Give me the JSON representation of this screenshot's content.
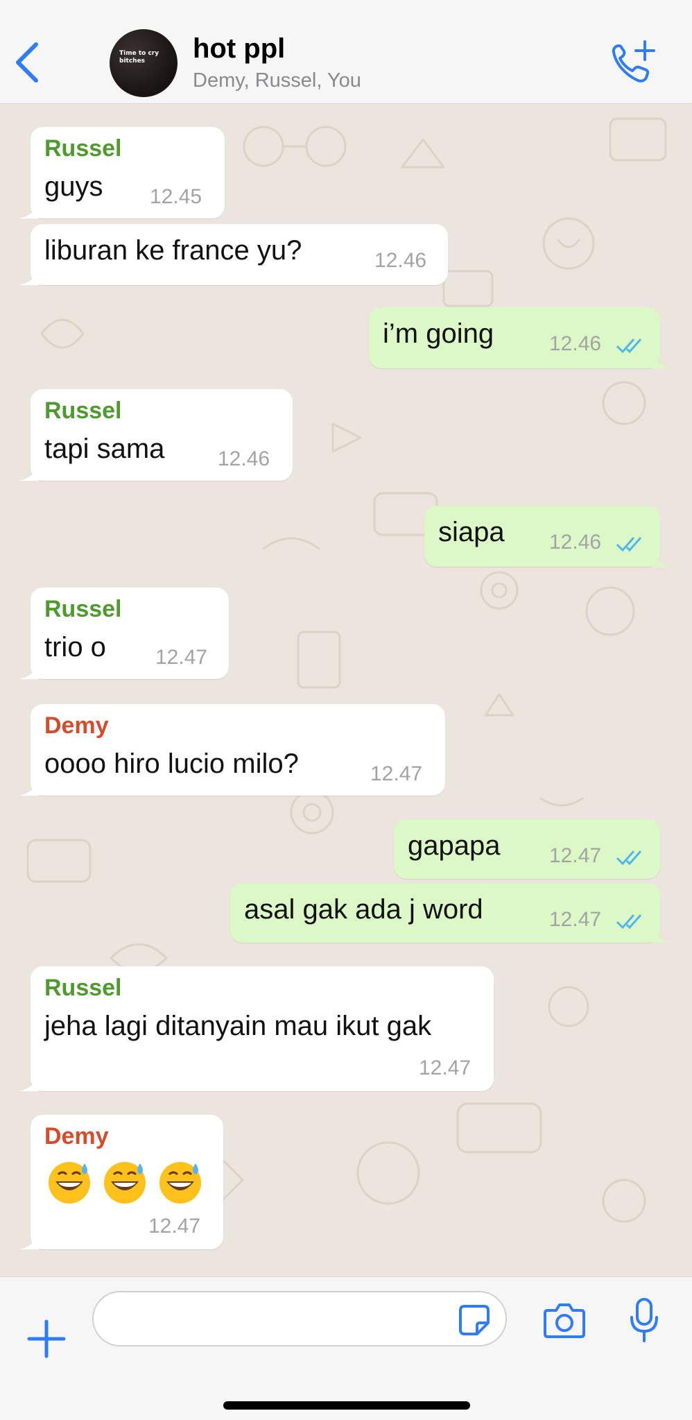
{
  "header": {
    "title": "hot ppl",
    "subtitle": "Demy, Russel, You",
    "avatar_caption": "Time to cry bitches",
    "back_icon": "chevron-left-icon",
    "call_icon": "phone-add-icon",
    "accent_color": "#2e7cf6"
  },
  "messages": [
    {
      "direction": "in",
      "sender": "Russel",
      "text": "guys",
      "time": "12.45"
    },
    {
      "direction": "in",
      "sender": "",
      "text": "liburan ke france yu?",
      "time": "12.46"
    },
    {
      "direction": "out",
      "text": "i’m going",
      "time": "12.46",
      "status": "read"
    },
    {
      "direction": "in",
      "sender": "Russel",
      "text": "tapi sama",
      "time": "12.46"
    },
    {
      "direction": "out",
      "text": "siapa",
      "time": "12.46",
      "status": "read"
    },
    {
      "direction": "in",
      "sender": "Russel",
      "text": "trio o",
      "time": "12.47"
    },
    {
      "direction": "in",
      "sender": "Demy",
      "text": "oooo hiro lucio milo?",
      "time": "12.47"
    },
    {
      "direction": "out",
      "text": "gapapa",
      "time": "12.47",
      "status": "read"
    },
    {
      "direction": "out",
      "text": "asal gak ada j word",
      "time": "12.47",
      "status": "read"
    },
    {
      "direction": "in",
      "sender": "Russel",
      "text": "jeha lagi ditanyain mau ikut gak",
      "time": "12.47"
    },
    {
      "direction": "in",
      "sender": "Demy",
      "text": "😅😅😅",
      "time": "12.47",
      "emoji_icons": [
        "grinning-sweat-emoji",
        "grinning-sweat-emoji",
        "grinning-sweat-emoji"
      ]
    }
  ],
  "composer": {
    "input_value": "",
    "input_placeholder": "",
    "plus_icon": "plus-icon",
    "sticker_icon": "sticker-icon",
    "camera_icon": "camera-icon",
    "mic_icon": "microphone-icon"
  },
  "colors": {
    "incoming_bubble": "#ffffff",
    "outgoing_bubble": "#dcf8c6",
    "sender_russel": "#4f9a2f",
    "sender_demy": "#d74a2a",
    "read_ticks": "#4fb6ec",
    "chat_background": "#ece5dd"
  }
}
